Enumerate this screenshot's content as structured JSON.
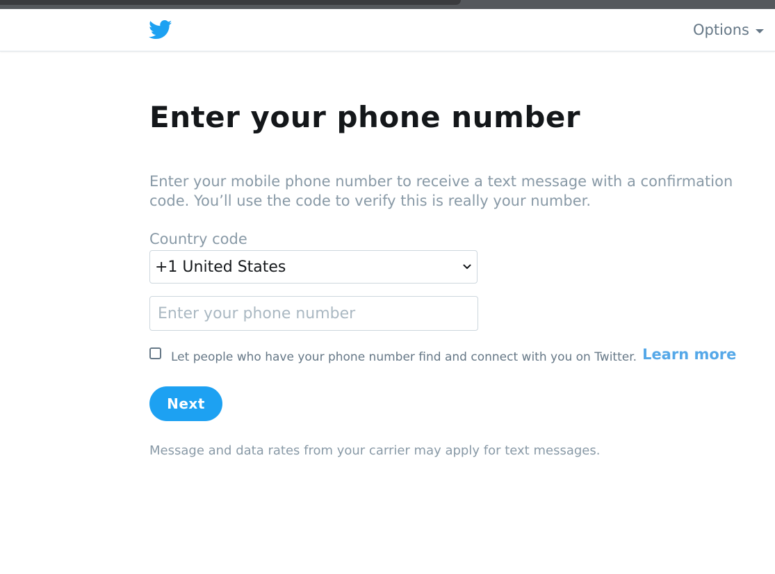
{
  "header": {
    "logo_icon": "twitter-bird-icon",
    "options_label": "Options",
    "options_icon": "caret-down-icon"
  },
  "page": {
    "title": "Enter your phone number",
    "description": "Enter your mobile phone number to receive a text message with a confirmation code. You’ll use the code to verify this is really your number."
  },
  "form": {
    "country_code_label": "Country code",
    "country_code_value": "+1 United States",
    "phone_placeholder": "Enter your phone number",
    "phone_value": "",
    "discoverable_label": "Let people who have your phone number find and connect with you on Twitter.",
    "discoverable_checked": false,
    "learn_more_label": "Learn more",
    "next_label": "Next",
    "rates_notice": "Message and data rates from your carrier may apply for text messages."
  },
  "colors": {
    "accent": "#1da1f2",
    "link": "#55a8e8",
    "muted_text": "#8899a6",
    "title_text": "#14171a"
  }
}
